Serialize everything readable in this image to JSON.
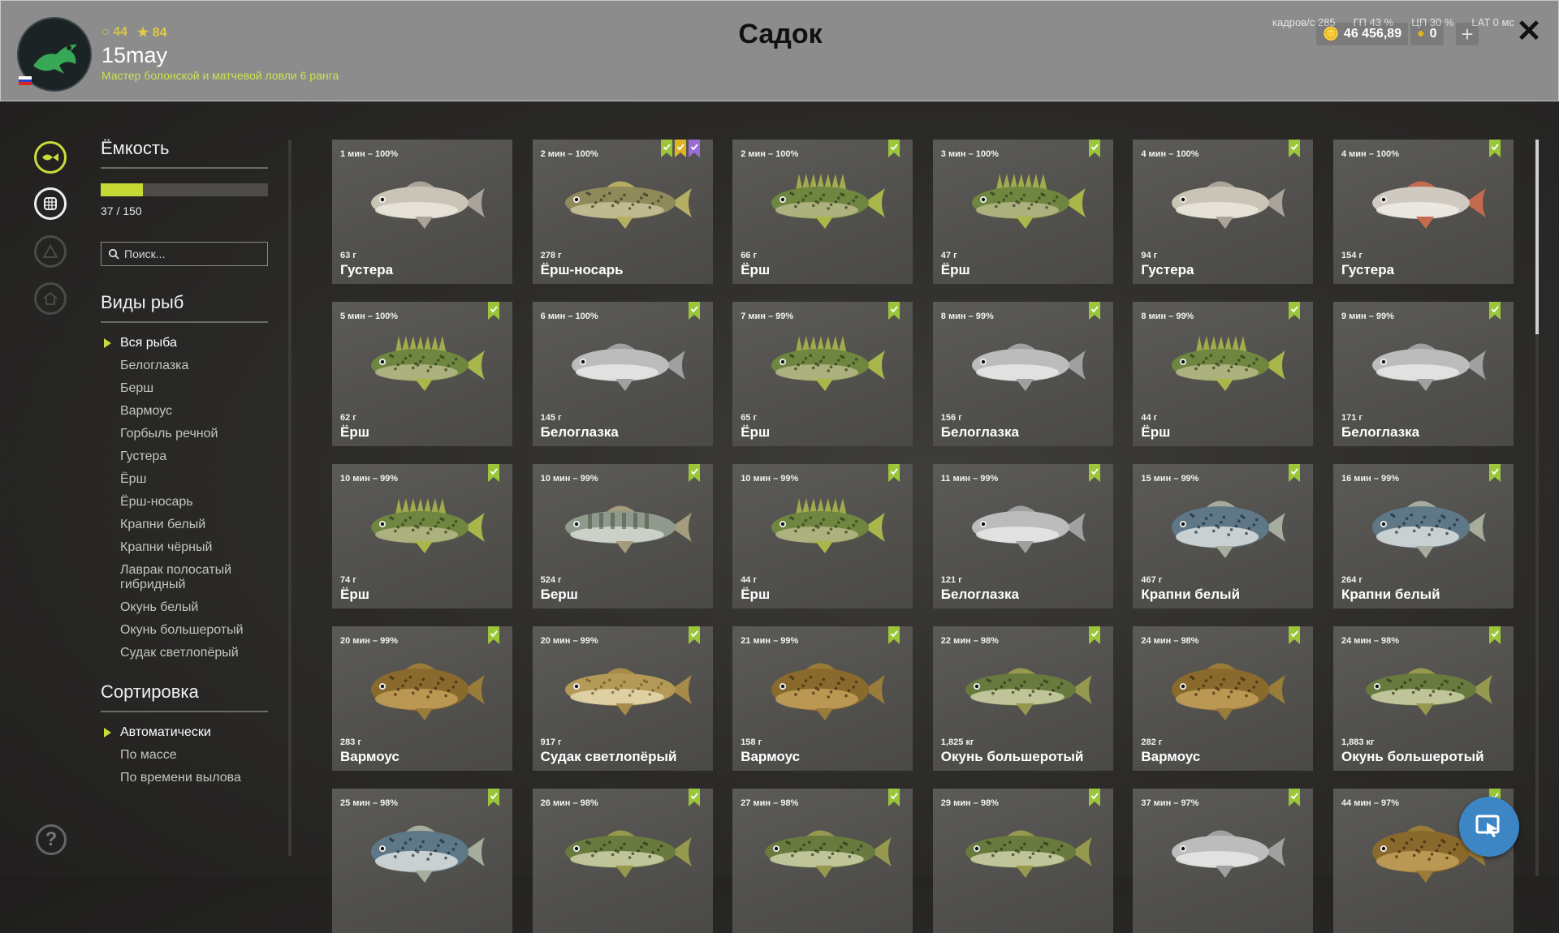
{
  "header": {
    "title": "Садок",
    "username": "15may",
    "rank_text": "Мастер болонской и матчевой ловли 6 ранга",
    "level": "44",
    "stars": "84",
    "perf": [
      "кадров/с 285",
      "ГП 43 %",
      "ЦП 30 %",
      "LAT 0 мс"
    ],
    "silver": "46 456,89",
    "gold": "0",
    "plus_label": "+",
    "close_label": "✕"
  },
  "sidebar": {
    "capacity_title": "Ёмкость",
    "capacity_fraction": 0.25,
    "capacity_text": "37 / 150",
    "search_placeholder": "Поиск...",
    "species_title": "Виды рыб",
    "species": [
      "Вся рыба",
      "Белоглазка",
      "Берш",
      "Вармоус",
      "Горбыль речной",
      "Густера",
      "Ёрш",
      "Ёрш-носарь",
      "Крапни белый",
      "Крапни чёрный",
      "Лаврак полосатый гибридный",
      "Окунь белый",
      "Окунь большеротый",
      "Судак светлопёрый"
    ],
    "sort_title": "Сортировка",
    "sort_options": [
      "Автоматически",
      "По массе",
      "По времени вылова"
    ],
    "help_label": "?"
  },
  "colors": {
    "accent": "#c5d935",
    "tag_green": "#9bc639",
    "tag_gold": "#e0b323",
    "tag_purple": "#9b6bd8",
    "fab": "#3d86c6"
  },
  "fish": [
    {
      "time": "1 мин – 100%",
      "weight": "63 г",
      "name": "Густера",
      "kind": "bream",
      "flags": []
    },
    {
      "time": "2 мин – 100%",
      "weight": "278 г",
      "name": "Ёрш-носарь",
      "kind": "perchlong",
      "flags": [
        "green",
        "gold",
        "purple"
      ]
    },
    {
      "time": "2 мин – 100%",
      "weight": "66 г",
      "name": "Ёрш",
      "kind": "ruffe",
      "flags": [
        "green"
      ]
    },
    {
      "time": "3 мин – 100%",
      "weight": "47 г",
      "name": "Ёрш",
      "kind": "ruffe",
      "flags": [
        "green"
      ]
    },
    {
      "time": "4 мин – 100%",
      "weight": "94 г",
      "name": "Густера",
      "kind": "bream",
      "flags": [
        "green"
      ]
    },
    {
      "time": "4 мин – 100%",
      "weight": "154 г",
      "name": "Густера",
      "kind": "breamred",
      "flags": [
        "green"
      ]
    },
    {
      "time": "5 мин – 100%",
      "weight": "62 г",
      "name": "Ёрш",
      "kind": "ruffe",
      "flags": [
        "green"
      ]
    },
    {
      "time": "6 мин – 100%",
      "weight": "145 г",
      "name": "Белоглазка",
      "kind": "white",
      "flags": [
        "green"
      ]
    },
    {
      "time": "7 мин – 99%",
      "weight": "65 г",
      "name": "Ёрш",
      "kind": "ruffe",
      "flags": [
        "green"
      ]
    },
    {
      "time": "8 мин – 99%",
      "weight": "156 г",
      "name": "Белоглазка",
      "kind": "white",
      "flags": [
        "green"
      ]
    },
    {
      "time": "8 мин – 99%",
      "weight": "44 г",
      "name": "Ёрш",
      "kind": "ruffe",
      "flags": [
        "green"
      ]
    },
    {
      "time": "9 мин – 99%",
      "weight": "171 г",
      "name": "Белоглазка",
      "kind": "white",
      "flags": [
        "green"
      ]
    },
    {
      "time": "10 мин – 99%",
      "weight": "74 г",
      "name": "Ёрш",
      "kind": "ruffe",
      "flags": [
        "green"
      ]
    },
    {
      "time": "10 мин – 99%",
      "weight": "524 г",
      "name": "Берш",
      "kind": "zander",
      "flags": [
        "green"
      ]
    },
    {
      "time": "10 мин – 99%",
      "weight": "44 г",
      "name": "Ёрш",
      "kind": "ruffe",
      "flags": [
        "green"
      ]
    },
    {
      "time": "11 мин – 99%",
      "weight": "121 г",
      "name": "Белоглазка",
      "kind": "white",
      "flags": [
        "green"
      ]
    },
    {
      "time": "15 мин – 99%",
      "weight": "467 г",
      "name": "Крапни белый",
      "kind": "crappie",
      "flags": [
        "green"
      ]
    },
    {
      "time": "16 мин – 99%",
      "weight": "264 г",
      "name": "Крапни белый",
      "kind": "crappie",
      "flags": [
        "green"
      ]
    },
    {
      "time": "20 мин – 99%",
      "weight": "283 г",
      "name": "Вармоус",
      "kind": "warmouth",
      "flags": [
        "green"
      ]
    },
    {
      "time": "20 мин – 99%",
      "weight": "917 г",
      "name": "Судак светлопёрый",
      "kind": "walleye",
      "flags": [
        "green"
      ]
    },
    {
      "time": "21 мин – 99%",
      "weight": "158 г",
      "name": "Вармоус",
      "kind": "warmouth",
      "flags": [
        "green"
      ]
    },
    {
      "time": "22 мин – 98%",
      "weight": "1,825 кг",
      "name": "Окунь большеротый",
      "kind": "bass",
      "flags": [
        "green"
      ]
    },
    {
      "time": "24 мин – 98%",
      "weight": "282 г",
      "name": "Вармоус",
      "kind": "warmouth",
      "flags": [
        "green"
      ]
    },
    {
      "time": "24 мин – 98%",
      "weight": "1,883 кг",
      "name": "Окунь большеротый",
      "kind": "bass",
      "flags": [
        "green"
      ]
    },
    {
      "time": "25 мин – 98%",
      "weight": "",
      "name": "",
      "kind": "crappie",
      "flags": [
        "green"
      ]
    },
    {
      "time": "26 мин – 98%",
      "weight": "",
      "name": "",
      "kind": "bass",
      "flags": [
        "green"
      ]
    },
    {
      "time": "27 мин – 98%",
      "weight": "",
      "name": "",
      "kind": "bass",
      "flags": [
        "green"
      ]
    },
    {
      "time": "29 мин – 98%",
      "weight": "",
      "name": "",
      "kind": "bass",
      "flags": [
        "green"
      ]
    },
    {
      "time": "37 мин – 97%",
      "weight": "",
      "name": "",
      "kind": "white",
      "flags": [
        "green"
      ]
    },
    {
      "time": "44 мин – 97%",
      "weight": "",
      "name": "",
      "kind": "warmouth",
      "flags": [
        "green"
      ]
    }
  ]
}
